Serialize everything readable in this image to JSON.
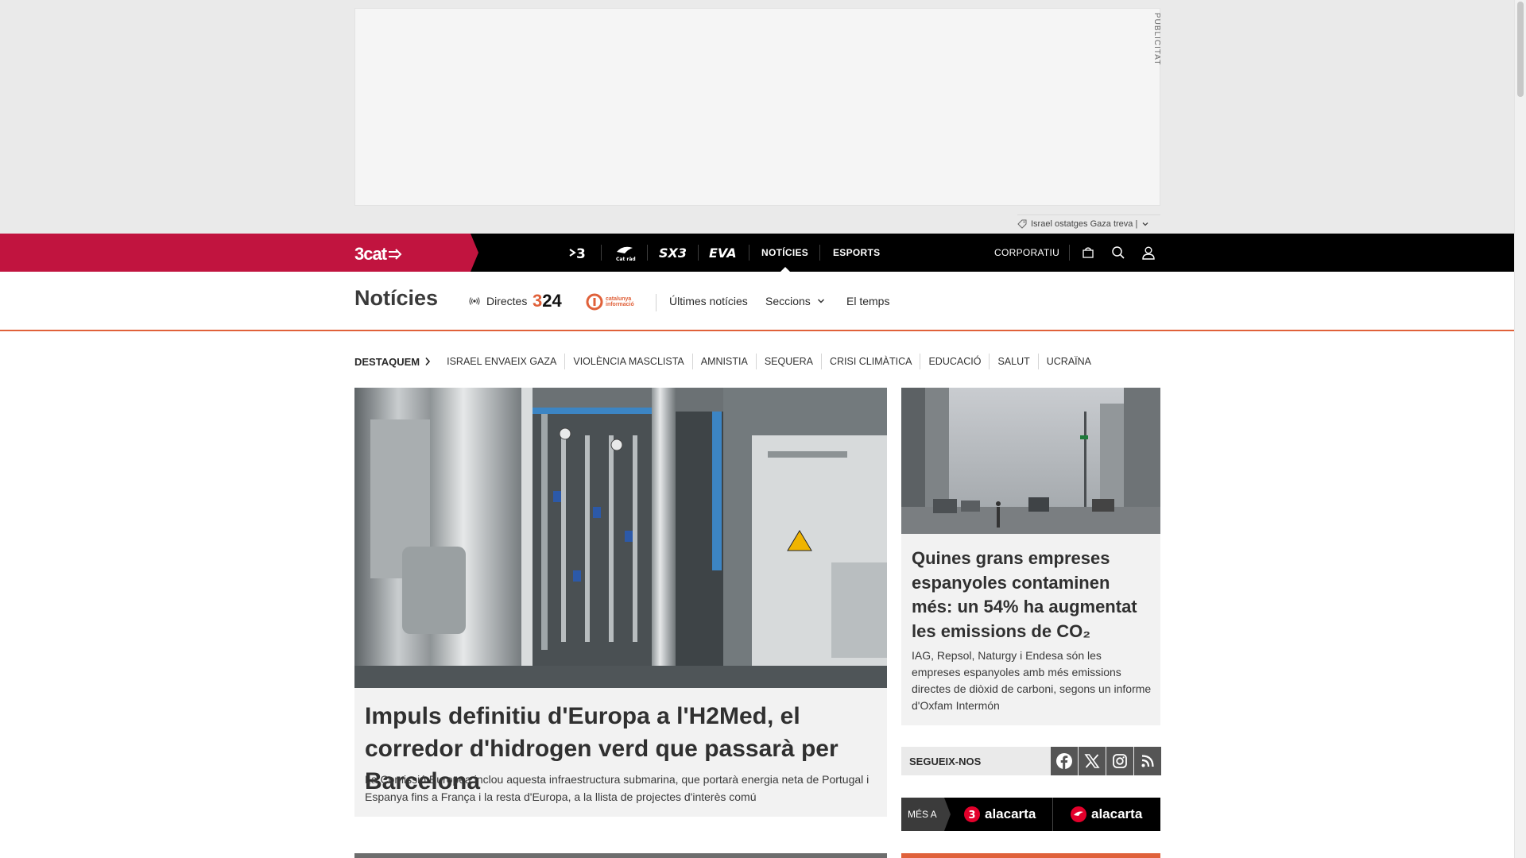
{
  "ad": {
    "label": "PUBLICITAT"
  },
  "ticker": {
    "text": "Israel ostatges Gaza treva |"
  },
  "topnav": {
    "brand": "3cat",
    "channels": [
      {
        "name": "tv3-icon",
        "label": "3"
      },
      {
        "name": "catradio-icon",
        "label": "Cat ràdio"
      },
      {
        "name": "sx3-icon",
        "label": "SX3"
      },
      {
        "name": "eva-icon",
        "label": "EVA"
      }
    ],
    "noticies": "NOTÍCIES",
    "esports": "ESPORTS",
    "corporatiu": "CORPORATIU",
    "colors": {
      "brand_red": "#c1143f",
      "accent_orange": "#e0613a"
    }
  },
  "section": {
    "title": "Notícies",
    "directes": "Directes",
    "logo_324": {
      "three": "3",
      "rest": "24"
    },
    "logo_catinfo": [
      "catalunya",
      "informació"
    ],
    "ultimes": "Últimes notícies",
    "seccions": "Seccions",
    "eltemps": "El temps"
  },
  "highlights": {
    "label": "DESTAQUEM",
    "items": [
      "ISRAEL ENVAEIX GAZA",
      "VIOLÈNCIA MASCLISTA",
      "AMNISTIA",
      "SEQUERA",
      "CRISI CLIMÀTICA",
      "EDUCACIÓ",
      "SALUT",
      "UCRAÏNA"
    ]
  },
  "main_story": {
    "headline": "Impuls definitiu d'Europa a l'H2Med, el corredor d'hidrogen verd que passarà per Barcelona",
    "lead": "La Comissió Europea inclou aquesta infraestructura submarina, que portarà energia neta de Portugal i Espanya fins a França i la resta d'Europa, a la llista de projectes d'interès comú"
  },
  "side_story": {
    "headline": "Quines grans empreses espanyoles contaminen més: un 54% ha augmentat les emissions de CO₂",
    "lead": "IAG, Repsol, Naturgy i Endesa són les empreses espanyoles amb més emissions directes de diòxid de carboni, segons un informe d'Oxfam Intermón"
  },
  "follow": {
    "label": "SEGUEIX-NOS",
    "networks": [
      "facebook-icon",
      "x-icon",
      "instagram-icon",
      "rss-icon"
    ]
  },
  "alacarta": {
    "mes_a": "MÉS A",
    "logo1": {
      "mark": "3",
      "text": "alacarta"
    },
    "logo2": {
      "text": "alacarta"
    }
  }
}
